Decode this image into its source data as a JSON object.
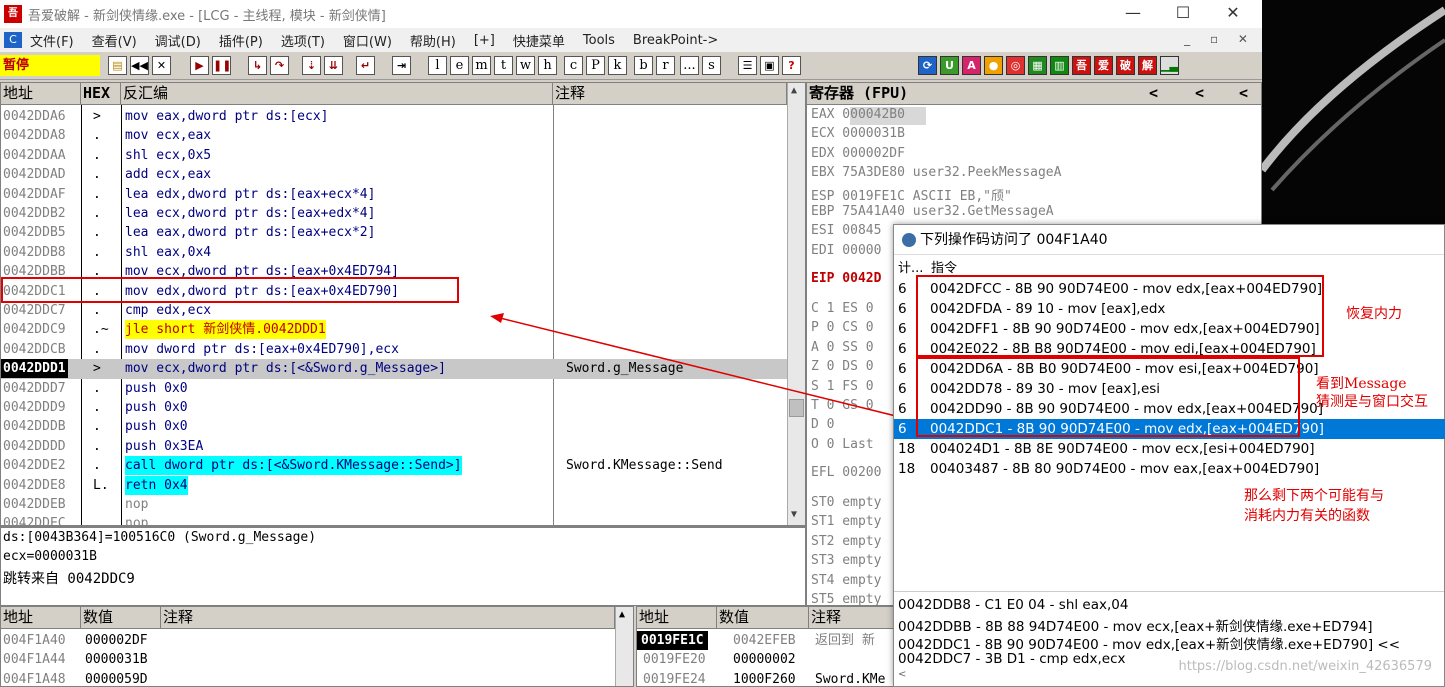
{
  "titlebar": {
    "icon_text": "吾",
    "title": "吾爱破解 - 新剑侠情缘.exe - [LCG - 主线程, 模块 - 新剑侠情]",
    "minimize": "—",
    "maximize": "☐",
    "close": "✕"
  },
  "menubar": {
    "logo": "C",
    "items": [
      "文件(F)",
      "查看(V)",
      "调试(D)",
      "插件(P)",
      "选项(T)",
      "窗口(W)",
      "帮助(H)",
      "[+]",
      "快捷菜单",
      "Tools",
      "BreakPoint->"
    ],
    "mdi_controls": "_ ▫ ✕"
  },
  "toolbar": {
    "status": "暂停",
    "letters": [
      "l",
      "e",
      "m",
      "t",
      "w",
      "h",
      "c",
      "P",
      "k",
      "b",
      "r",
      "...",
      "s"
    ],
    "question": "?"
  },
  "disasm": {
    "headers": [
      "地址",
      "HEX",
      "反汇编",
      "注释"
    ],
    "rows": [
      {
        "addr": "0042DDA6",
        "mark": ">",
        "asm": "mov eax,dword ptr ds:[ecx]",
        "cmt": ""
      },
      {
        "addr": "0042DDA8",
        "mark": ".",
        "asm": "mov ecx,eax",
        "cmt": ""
      },
      {
        "addr": "0042DDAA",
        "mark": ".",
        "asm": "shl ecx,0x5",
        "cmt": ""
      },
      {
        "addr": "0042DDAD",
        "mark": ".",
        "asm": "add ecx,eax",
        "cmt": ""
      },
      {
        "addr": "0042DDAF",
        "mark": ".",
        "asm": "lea edx,dword ptr ds:[eax+ecx*4]",
        "cmt": ""
      },
      {
        "addr": "0042DDB2",
        "mark": ".",
        "asm": "lea ecx,dword ptr ds:[eax+edx*4]",
        "cmt": ""
      },
      {
        "addr": "0042DDB5",
        "mark": ".",
        "asm": "lea eax,dword ptr ds:[eax+ecx*2]",
        "cmt": ""
      },
      {
        "addr": "0042DDB8",
        "mark": ".",
        "asm": "shl eax,0x4",
        "cmt": ""
      },
      {
        "addr": "0042DDBB",
        "mark": ".",
        "asm": "mov ecx,dword ptr ds:[eax+0x4ED794]",
        "cmt": ""
      },
      {
        "addr": "0042DDC1",
        "mark": ".",
        "asm": "mov edx,dword ptr ds:[eax+0x4ED790]",
        "cmt": ""
      },
      {
        "addr": "0042DDC7",
        "mark": ".",
        "asm": "cmp edx,ecx",
        "cmt": ""
      },
      {
        "addr": "0042DDC9",
        "mark": ".~",
        "asm": "jle short 新剑侠情.0042DDD1",
        "cmt": ""
      },
      {
        "addr": "0042DDCB",
        "mark": ".",
        "asm": "mov dword ptr ds:[eax+0x4ED790],ecx",
        "cmt": ""
      },
      {
        "addr": "0042DDD1",
        "mark": ">",
        "asm": "mov ecx,dword ptr ds:[<&Sword.g_Message>]",
        "cmt": "Sword.g_Message"
      },
      {
        "addr": "0042DDD7",
        "mark": ".",
        "asm": "push 0x0",
        "cmt": ""
      },
      {
        "addr": "0042DDD9",
        "mark": ".",
        "asm": "push 0x0",
        "cmt": ""
      },
      {
        "addr": "0042DDDB",
        "mark": ".",
        "asm": "push 0x0",
        "cmt": ""
      },
      {
        "addr": "0042DDDD",
        "mark": ".",
        "asm": "push 0x3EA",
        "cmt": ""
      },
      {
        "addr": "0042DDE2",
        "mark": ".",
        "asm": "call dword ptr ds:[<&Sword.KMessage::Send>]",
        "cmt": "Sword.KMessage::Send"
      },
      {
        "addr": "0042DDE8",
        "mark": "L.",
        "asm": "retn 0x4",
        "cmt": ""
      },
      {
        "addr": "0042DDEB",
        "mark": "",
        "asm": "nop",
        "cmt": ""
      },
      {
        "addr": "0042DDEC",
        "mark": "",
        "asm": "nop",
        "cmt": ""
      }
    ]
  },
  "info": {
    "line1": "ds:[0043B364]=100516C0 (Sword.g_Message)",
    "line2": "ecx=0000031B",
    "line3": "跳转来自 0042DDC9"
  },
  "registers": {
    "header": "寄存器 (FPU)",
    "nav": [
      "<",
      "<",
      "<"
    ],
    "rows": [
      "EAX 000042B0",
      "ECX 0000031B",
      "EDX 000002DF",
      "EBX 75A3DE80 user32.PeekMessageA",
      "ESP 0019FE1C ASCII EB,\"颀\"",
      "EBP 75A41A40 user32.GetMessageA",
      "ESI 00845",
      "EDI 00000"
    ],
    "eip": "EIP 0042D",
    "flags": [
      "C 1  ES 0",
      "P 0  CS 0",
      "A 0  SS 0",
      "Z 0  DS 0",
      "S 1  FS 0",
      "T 0  GS 0",
      "D 0",
      "O 0  Last"
    ],
    "efl": "EFL 00200",
    "st": [
      "ST0 empty",
      "ST1 empty",
      "ST2 empty",
      "ST3 empty",
      "ST4 empty",
      "ST5 empty"
    ]
  },
  "dump": {
    "headers": [
      "地址",
      "数值",
      "注释"
    ],
    "rows": [
      {
        "addr": "004F1A40",
        "val": "000002DF"
      },
      {
        "addr": "004F1A44",
        "val": "0000031B"
      },
      {
        "addr": "004F1A48",
        "val": "0000059D"
      }
    ]
  },
  "stack": {
    "headers": [
      "地址",
      "数值",
      "注释"
    ],
    "rows": [
      {
        "addr": "0019FE1C",
        "val": "0042EFEB",
        "cmt": "返回到 新"
      },
      {
        "addr": "0019FE20",
        "val": "00000002",
        "cmt": ""
      },
      {
        "addr": "0019FE24",
        "val": "1000F260",
        "cmt": "Sword.KMe"
      }
    ]
  },
  "popup": {
    "title": "下列操作码访问了 004F1A40",
    "col_count": "计...",
    "col_instr": "指令",
    "rows": [
      {
        "count": "6",
        "instr": "0042DFCC - 8B 90 90D74E00  - mov edx,[eax+004ED790]"
      },
      {
        "count": "6",
        "instr": "0042DFDA - 89 10  - mov [eax],edx"
      },
      {
        "count": "6",
        "instr": "0042DFF1 - 8B 90 90D74E00  - mov edx,[eax+004ED790]"
      },
      {
        "count": "6",
        "instr": "0042E022 - 8B B8 90D74E00  - mov edi,[eax+004ED790]"
      },
      {
        "count": "6",
        "instr": "0042DD6A - 8B B0 90D74E00  - mov esi,[eax+004ED790]"
      },
      {
        "count": "6",
        "instr": "0042DD78 - 89 30  - mov [eax],esi"
      },
      {
        "count": "6",
        "instr": "0042DD90 - 8B 90 90D74E00  - mov edx,[eax+004ED790]"
      },
      {
        "count": "6",
        "instr": "0042DDC1 - 8B 90 90D74E00  - mov edx,[eax+004ED790]"
      },
      {
        "count": "18",
        "instr": "004024D1 - 8B 8E 90D74E00  - mov ecx,[esi+004ED790]"
      },
      {
        "count": "18",
        "instr": "00403487 - 8B 80 90D74E00  - mov eax,[eax+004ED790]"
      }
    ],
    "anno1": "恢复内力",
    "anno2a": "看到Message",
    "anno2b": "猜测是与窗口交互",
    "anno3a": "那么剩下两个可能有与",
    "anno3b": "消耗内力有关的函数",
    "log": [
      "0042DDB8 - C1 E0 04 - shl eax,04",
      "0042DDBB - 8B 88 94D74E00  - mov ecx,[eax+新剑侠情缘.exe+ED794]",
      "0042DDC1 - 8B 90 90D74E00  - mov edx,[eax+新剑侠情缘.exe+ED790] <<",
      "0042DDC7 - 3B D1  - cmp edx,ecx"
    ],
    "watermark": "https://blog.csdn.net/weixin_42636579"
  }
}
